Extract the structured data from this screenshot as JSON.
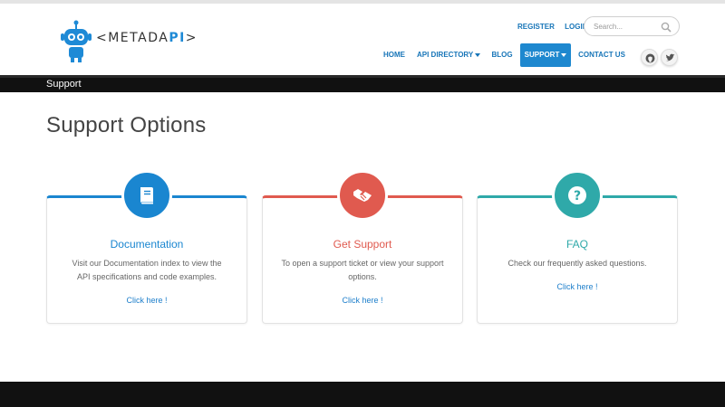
{
  "brand": {
    "logo_prefix": "<METADA",
    "logo_accent": "PI",
    "logo_suffix": ">",
    "accent_color": "#1e8ad6"
  },
  "utility_links": {
    "register": "REGISTER",
    "login": "LOGIN"
  },
  "search": {
    "placeholder": "Search..."
  },
  "nav": {
    "items": [
      {
        "label": "HOME",
        "dropdown": false,
        "active": false
      },
      {
        "label": "API DIRECTORY",
        "dropdown": true,
        "active": false
      },
      {
        "label": "BLOG",
        "dropdown": false,
        "active": false
      },
      {
        "label": "SUPPORT",
        "dropdown": true,
        "active": true
      },
      {
        "label": "CONTACT US",
        "dropdown": false,
        "active": false
      }
    ],
    "active_color": "#1e88cf"
  },
  "social": [
    {
      "icon": "github-icon"
    },
    {
      "icon": "twitter-icon"
    }
  ],
  "breadcrumb": {
    "current": "Support"
  },
  "page": {
    "title": "Support Options"
  },
  "cards": [
    {
      "title": "Documentation",
      "description": "Visit our Documentation index to view the API specifications and code examples.",
      "link": "Click here !",
      "color": "#1a86d0",
      "icon": "book-icon"
    },
    {
      "title": "Get Support",
      "description": "To open a support ticket or view your support options.",
      "link": "Click here !",
      "color": "#e05a4f",
      "icon": "handshake-icon"
    },
    {
      "title": "FAQ",
      "description": "Check our frequently asked questions.",
      "link": "Click here !",
      "color": "#2fa9a9",
      "icon": "question-icon"
    }
  ]
}
